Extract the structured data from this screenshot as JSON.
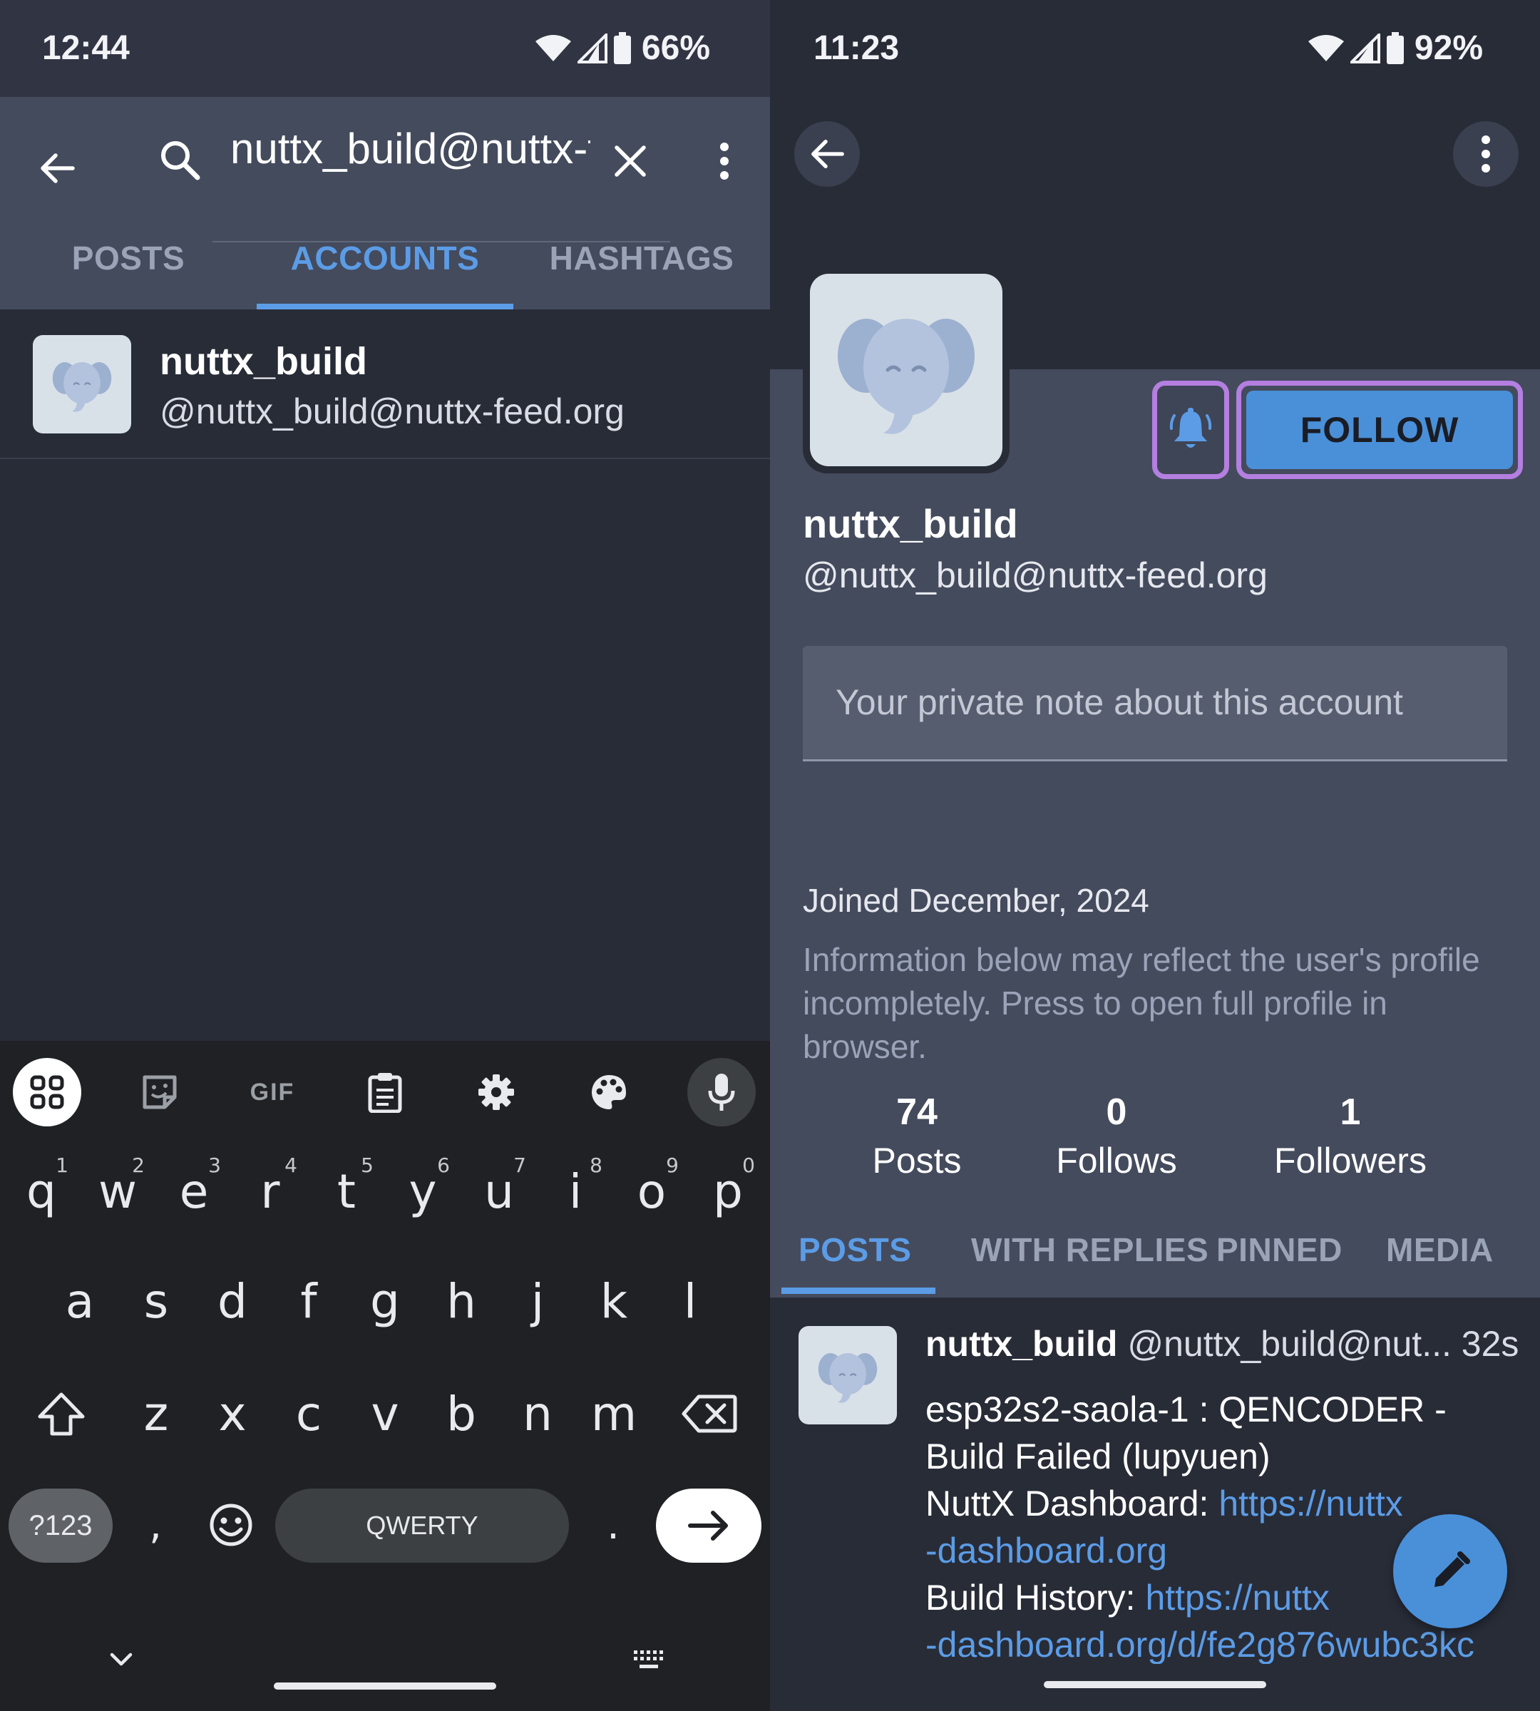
{
  "left": {
    "status": {
      "time": "12:44",
      "battery": "66%"
    },
    "search": {
      "query": "nuttx_build@nuttx-feed.org"
    },
    "tabs": [
      "POSTS",
      "ACCOUNTS",
      "HASHTAGS"
    ],
    "active_tab": "ACCOUNTS",
    "result": {
      "name": "nuttx_build",
      "handle": "@nuttx_build@nuttx-feed.org"
    },
    "keyboard": {
      "toolbar_icons": [
        "apps-grid-icon",
        "sticker-icon",
        "gif-icon",
        "clipboard-icon",
        "settings-gear-icon",
        "palette-icon",
        "microphone-icon"
      ],
      "gif_label": "GIF",
      "row1": [
        "q",
        "w",
        "e",
        "r",
        "t",
        "y",
        "u",
        "i",
        "o",
        "p"
      ],
      "row1_hints": [
        "1",
        "2",
        "3",
        "4",
        "5",
        "6",
        "7",
        "8",
        "9",
        "0"
      ],
      "row2": [
        "a",
        "s",
        "d",
        "f",
        "g",
        "h",
        "j",
        "k",
        "l"
      ],
      "row3": [
        "z",
        "x",
        "c",
        "v",
        "b",
        "n",
        "m"
      ],
      "symbols_label": "?123",
      "comma": ",",
      "space_label": "QWERTY",
      "period": "."
    }
  },
  "right": {
    "status": {
      "time": "11:23",
      "battery": "92%"
    },
    "profile": {
      "name": "nuttx_build",
      "handle": "@nuttx_build@nuttx-feed.org",
      "follow_label": "FOLLOW",
      "note_placeholder": "Your private note about this account",
      "joined": "Joined December, 2024",
      "info": "Information below may reflect the user's profile incompletely. Press to open full profile in browser."
    },
    "stats": [
      {
        "value": "74",
        "label": "Posts"
      },
      {
        "value": "0",
        "label": "Follows"
      },
      {
        "value": "1",
        "label": "Followers"
      }
    ],
    "tabs": [
      "POSTS",
      "WITH REPLIES",
      "PINNED",
      "MEDIA"
    ],
    "active_tab": "POSTS",
    "post": {
      "author": "nuttx_build",
      "handle": "@nuttx_build@nut...",
      "time": "32s",
      "line1": "esp32s2-saola-1 : QENCODER -",
      "line2": "Build Failed (lupyuen)",
      "dashboard_label": "NuttX Dashboard: ",
      "dashboard_link_a": "https://nuttx",
      "dashboard_link_b": "-dashboard.org",
      "history_label": "Build History: ",
      "history_link_a": "https://nuttx",
      "history_link_b": "-dashboard.org/d/fe2g876wubc3kc"
    }
  },
  "colors": {
    "accent": "#5c9ce6",
    "highlight": "#b47fe0",
    "follow_button": "#4a90d9",
    "background": "#282c37"
  }
}
